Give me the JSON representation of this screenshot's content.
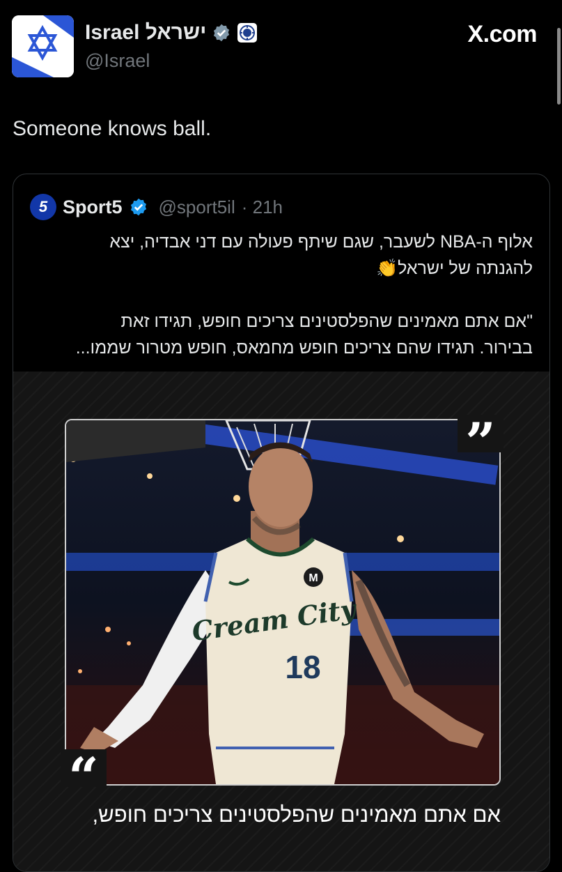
{
  "post": {
    "author_name": "Israel ישראל",
    "author_handle": "@Israel",
    "site": "X.com",
    "text": "Someone knows ball."
  },
  "quote": {
    "author_name": "Sport5",
    "author_handle": "@sport5il",
    "age": "· 21h",
    "lines": [
      "אלוף ה-NBA לשעבר, שגם שיתף פעולה עם דני אבדיה, יצא",
      "להגנתה של ישראל👏",
      "\"אם אתם מאמינים שהפלסטינים צריכים חופש, תגידו זאת",
      "בבירור. תגידו שהם צריכים חופש מחמאס, חופש מטרור שממו..."
    ],
    "media": {
      "jersey_text": "Cream City",
      "jersey_number": "18",
      "caption": "אם אתם מאמינים שהפלסטינים צריכים חופש,"
    }
  },
  "colors": {
    "background": "#000000",
    "verified_israel": "#829aab",
    "verified_sport5": "#1d9bf0",
    "israel_blue": "#2b56d6"
  },
  "icons": [
    "star-of-david-icon",
    "verified-gray-icon",
    "government-seal-icon",
    "verified-blue-icon",
    "sport5-logo-icon"
  ]
}
